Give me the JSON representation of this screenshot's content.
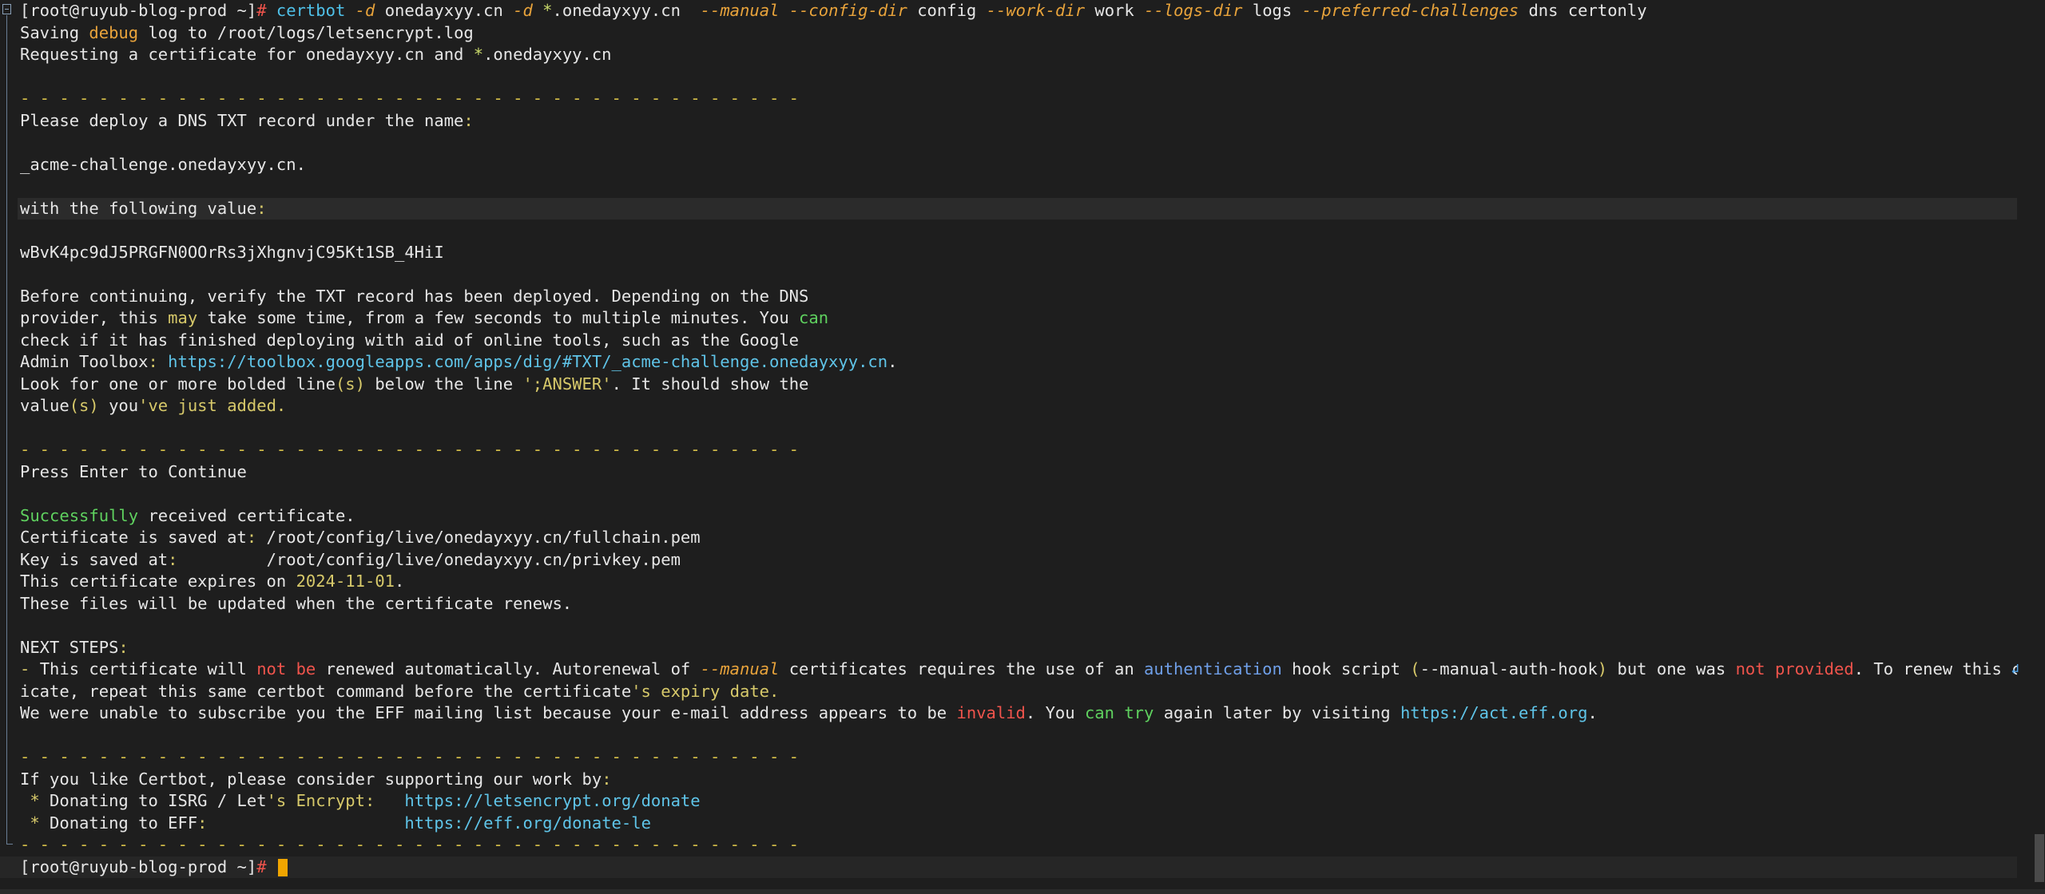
{
  "prompt": {
    "user_host": "[root@ruyub-blog-prod ~]",
    "symbol": "#"
  },
  "command": {
    "program": "certbot",
    "flag_d1": "-d",
    "domain1": "onedayxyy.cn",
    "flag_d2": "-d",
    "star": "*",
    "domain2": ".onedayxyy.cn",
    "flag_manual": "--manual",
    "flag_config": "--config-dir",
    "val_config": "config",
    "flag_work": "--work-dir",
    "val_work": "work",
    "flag_logs": "--logs-dir",
    "val_logs": "logs",
    "flag_pref": "--preferred-challenges",
    "val_pref": "dns certonly"
  },
  "output": {
    "saving_a": "Saving ",
    "saving_debug": "debug",
    "saving_b": " log to /root/logs/letsencrypt.log",
    "requesting_a": "Requesting a certificate for onedayxyy.cn and ",
    "requesting_star": "*",
    "requesting_b": ".onedayxyy.cn",
    "dashes": "- - - - - - - - - - - - - - - - - - - - - - - - - - - - - - - - - - - - - - - -",
    "deploy_a": "Please deploy a DNS TXT record under the name",
    "colon": ":",
    "acme_name": "_acme-challenge.onedayxyy.cn.",
    "with_value_a": "with the following value",
    "txt_value": "wBvK4pc9dJ5PRGFN0OOrRs3jXhgnvjC95Kt1SB_4HiI",
    "before_1": "Before continuing, verify the TXT record has been deployed. Depending on the DNS",
    "before_2a": "provider, this ",
    "before_2may": "may",
    "before_2b": " take some time, from a few seconds to multiple minutes. You ",
    "before_2can": "can",
    "before_3": "check if it has finished deploying with aid of online tools, such as the Google",
    "before_4a": "Admin Toolbox",
    "before_4url": "https://toolbox.googleapps.com/apps/dig/#TXT/_acme-challenge.onedayxyy.cn",
    "before_4end": ".",
    "before_5a": "Look for one or more bolded line",
    "before_5s": "(s)",
    "before_5b": " below the line ",
    "before_5ans": "';ANSWER'",
    "before_5c": ". It should show the",
    "before_6a": "value",
    "before_6s": "(s)",
    "before_6b": " you",
    "before_6c": "'ve just added.",
    "press_enter": "Press Enter to Continue",
    "success_word": "Successfully",
    "success_rest": " received certificate.",
    "cert_saved_a": "Certificate is saved at",
    "cert_saved_b": " /root/config/live/onedayxyy.cn/fullchain.pem",
    "key_saved_a": "Key is saved at",
    "key_saved_b": "         /root/config/live/onedayxyy.cn/privkey.pem",
    "expires_a": "This certificate expires on ",
    "expires_date": "2024-11-01",
    "expires_end": ".",
    "update_line": "These files will be updated when the certificate renews.",
    "next_steps": "NEXT STEPS",
    "ns1_dash": "- ",
    "ns1_a": "This certificate will ",
    "ns1_notbe": "not be",
    "ns1_b": " renewed automatically. Autorenewal of ",
    "ns1_manual": "--manual",
    "ns1_c": " certificates requires the use of an ",
    "ns1_auth": "authentication",
    "ns1_d": " hook script ",
    "ns1_paren_o": "(",
    "ns1_hook": "--manual-auth-hook",
    "ns1_paren_c": ")",
    "ns1_e": " but one was ",
    "ns1_notprov": "not provided",
    "ns1_f": ". To renew this certif",
    "ns2_a": "icate, repeat this same certbot command before the certificate",
    "ns2_b": "'s expiry date.",
    "eff_a": "We were unable to subscribe you the EFF mailing list because your e-mail address appears to be ",
    "eff_invalid": "invalid",
    "eff_b": ". You ",
    "eff_cantry": "can try",
    "eff_c": " again later by visiting ",
    "eff_url": "https://act.eff.org",
    "eff_end": ".",
    "like_a": "If you like Certbot, please consider supporting our work by",
    "don1_star": " * ",
    "don1_a": "Donating to ISRG / Let",
    "don1_b": "'s Encrypt:",
    "don1_gap": "   ",
    "don1_url": "https://letsencrypt.org/donate",
    "don2_star": " * ",
    "don2_a": "Donating to EFF",
    "don2_colon": ":",
    "don2_gap": "                    ",
    "don2_url": "https://eff.org/donate-le"
  },
  "icons": {
    "wrap": "↲"
  },
  "colors": {
    "background": "#1e1e1e",
    "command": "#4fc1e9",
    "flag": "#e8a33b",
    "success": "#5fd15f",
    "error": "#f0544c",
    "url": "#5fc4e8",
    "cursor": "#f0a500"
  }
}
